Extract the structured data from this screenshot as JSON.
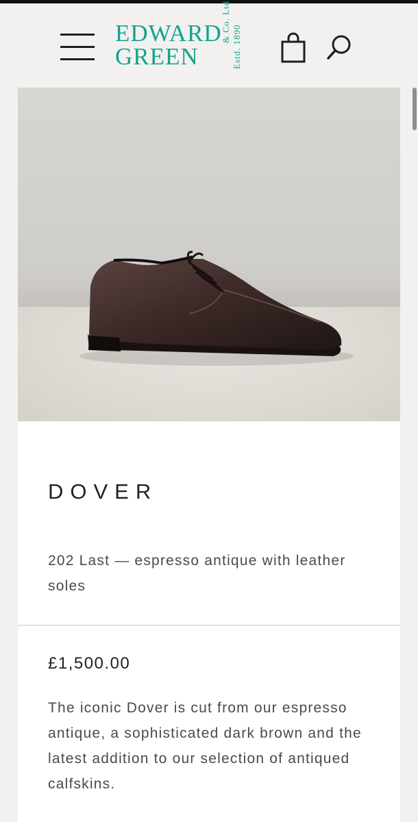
{
  "brand": {
    "line1": "EDWARD",
    "line2": "GREEN",
    "vertical1": "& Co. Ltd.",
    "vertical2": "Estd. 1890",
    "color": "#12a38e"
  },
  "header": {
    "menu_icon": "hamburger-menu-icon",
    "bag_icon": "shopping-bag-icon",
    "search_icon": "search-icon"
  },
  "product": {
    "name": "DOVER",
    "subtitle": "202 Last — espresso antique with leather soles",
    "price": "£1,500.00",
    "description": "The iconic Dover is cut from our espresso antique, a sophisticated dark brown and the latest addition to our selection of antiqued calfskins."
  }
}
